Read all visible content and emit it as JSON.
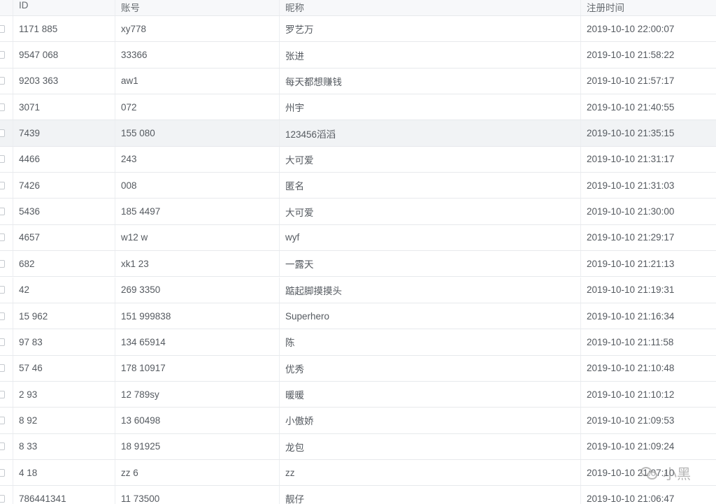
{
  "table": {
    "columns": [
      "ID",
      "账号",
      "昵称",
      "注册时间"
    ],
    "rows": [
      {
        "id": "1171   885",
        "account": "xy778",
        "nickname": "罗艺万",
        "time": "2019-10-10 22:00:07"
      },
      {
        "id": "9547  068",
        "account": "33366",
        "nickname": "张进",
        "time": "2019-10-10 21:58:22"
      },
      {
        "id": "9203  363",
        "account": "aw1",
        "nickname": "每天都想赚钱",
        "time": "2019-10-10 21:57:17"
      },
      {
        "id": "3071",
        "account": "072",
        "nickname": "州宇",
        "time": "2019-10-10 21:40:55"
      },
      {
        "id": "7439",
        "account": "155    080",
        "nickname": "123456滔滔",
        "time": "2019-10-10 21:35:15"
      },
      {
        "id": "4466",
        "account": "243",
        "nickname": "大可爱",
        "time": "2019-10-10 21:31:17"
      },
      {
        "id": "7426",
        "account": "008",
        "nickname": "匿名",
        "time": "2019-10-10 21:31:03"
      },
      {
        "id": "5436",
        "account": "185   4497",
        "nickname": "大可爱",
        "time": "2019-10-10 21:30:00"
      },
      {
        "id": "4657",
        "account": "w12    w",
        "nickname": "wyf",
        "time": "2019-10-10 21:29:17"
      },
      {
        "id": "682",
        "account": "xk1   23",
        "nickname": "一露天",
        "time": "2019-10-10 21:21:13"
      },
      {
        "id": "42",
        "account": "269   3350",
        "nickname": "踮起脚摸摸头",
        "time": "2019-10-10 21:19:31"
      },
      {
        "id": "15   962",
        "account": "151   999838",
        "nickname": "Superhero",
        "time": "2019-10-10 21:16:34"
      },
      {
        "id": "97   83",
        "account": "134   65914",
        "nickname": "陈",
        "time": "2019-10-10 21:11:58"
      },
      {
        "id": "57   46",
        "account": "178   10917",
        "nickname": "优秀",
        "time": "2019-10-10 21:10:48"
      },
      {
        "id": "2   93",
        "account": "12   789sy",
        "nickname": "暖暖",
        "time": "2019-10-10 21:10:12"
      },
      {
        "id": "8   92",
        "account": "13   60498",
        "nickname": "小傲娇",
        "time": "2019-10-10 21:09:53"
      },
      {
        "id": "8   33",
        "account": "18   91925",
        "nickname": "龙包",
        "time": "2019-10-10 21:09:24"
      },
      {
        "id": "4   18",
        "account": "zz   6",
        "nickname": "zz",
        "time": "2019-10-10 21:07:10"
      },
      {
        "id": "786441341",
        "account": "11   73500",
        "nickname": "靓仔",
        "time": "2019-10-10 21:06:47"
      }
    ],
    "highlighted_row": 4
  },
  "watermark": {
    "text": "小黑",
    "icon": "wechat-icon"
  },
  "colors": {
    "header_bg": "#f7f8fa",
    "row_border": "#e7e9ec",
    "highlight_bg": "#f1f3f5",
    "text": "#555a60"
  }
}
